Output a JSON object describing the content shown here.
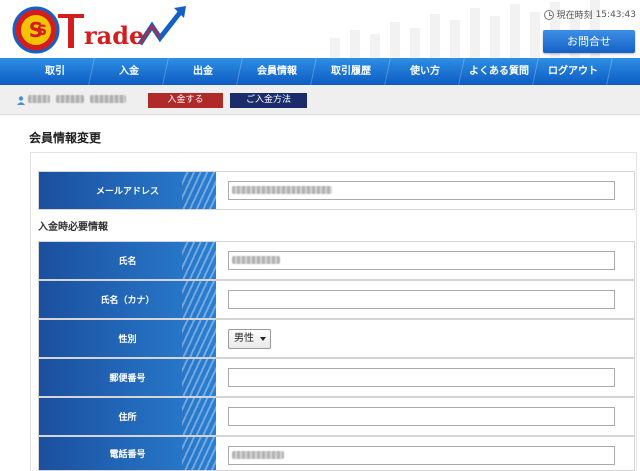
{
  "header": {
    "logo_text": "Trade",
    "clock_label": "現在時刻",
    "clock_time": "15:43:43",
    "contact_label": "お問合せ"
  },
  "nav": {
    "items": [
      "取引",
      "入金",
      "出金",
      "会員情報",
      "取引履歴",
      "使い方",
      "よくある質問",
      "ログアウト"
    ]
  },
  "userbar": {
    "deposit_label": "入金する",
    "method_label": "ご入金方法"
  },
  "page": {
    "title": "会員情報変更",
    "section_title": "入金時必要情報"
  },
  "form": {
    "email_label": "メールアドレス",
    "name_label": "氏名",
    "kana_label": "氏名（カナ）",
    "gender_label": "性別",
    "gender_value": "男性",
    "postal_label": "郵便番号",
    "address_label": "住所",
    "phone_label": "電話番号"
  },
  "colors": {
    "nav_blue": "#0d5bc2",
    "deposit_red": "#b02a2a",
    "method_navy": "#1a2d6a",
    "label_blue": "#1b4f9e"
  }
}
